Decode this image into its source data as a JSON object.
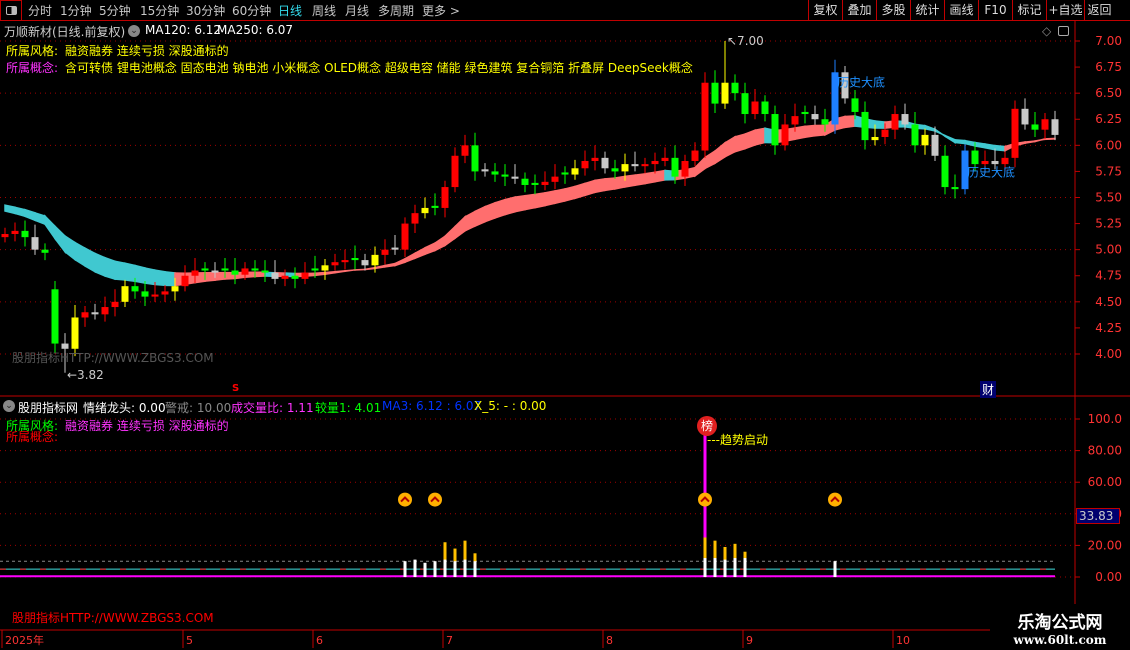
{
  "toolbar": {
    "tabs": [
      "分时",
      "1分钟",
      "5分钟",
      "15分钟",
      "30分钟",
      "60分钟",
      "日线",
      "周线",
      "月线",
      "多周期",
      "更多 >"
    ],
    "active": "日线",
    "buttons": [
      "复权",
      "叠加",
      "多股",
      "统计",
      "画线",
      "F10",
      "标记",
      "+自选",
      "返回"
    ]
  },
  "header": {
    "title": "万顺新材(日线.前复权)",
    "ma120": "MA120: 6.12",
    "ma250": "MA250: 6.07",
    "style_label": "所属风格:",
    "style_value": "融资融券 连续亏损 深股通标的",
    "concept_label": "所属概念:",
    "concept_value": "含可转债 锂电池概念 固态电池 钠电池 小米概念 OLED概念 超级电容 储能 绿色建筑 复合铜箔 折叠屏 DeepSeek概念"
  },
  "main_watermark": "股朋指标HTTP://WWW.ZBGS3.COM",
  "indicator": {
    "name": "股朋指标网",
    "emo": "情绪龙头: 0.00",
    "warn": "警戒: 10.00",
    "volratio": "成交量比: 1.11",
    "jl": "较量1: 4.01",
    "ma3": "MA3: 6.12 : 6.07",
    "x5": "X_5: - : 0.00",
    "style_label": "所属风格:",
    "style_value": "融资融券 连续亏损 深股通标的",
    "concept_label": "所属概念:",
    "badge": "榜",
    "badge_note": "---趋势启动",
    "current_value": "33.83",
    "watermark": "股朋指标HTTP://WWW.ZBGS3.COM"
  },
  "logo": {
    "name": "乐淘公式网",
    "url": "www.60lt.com"
  },
  "markers": {
    "s": "S",
    "cai": "财"
  },
  "colors": {
    "up": "#ff0000",
    "down": "#00ff00",
    "accent": "#33ddee",
    "axis": "#c00000",
    "ma_up": "#ff6e6e",
    "ma_down": "#40c8d0"
  },
  "chart_data": [
    {
      "type": "candlestick",
      "title": "万顺新材(日线.前复权)",
      "y_ticks": [
        "7.00",
        "6.75",
        "6.50",
        "6.25",
        "6.00",
        "5.75",
        "5.50",
        "5.25",
        "5.00",
        "4.75",
        "4.50",
        "4.25",
        "4.00"
      ],
      "ylim": [
        3.75,
        7.1
      ],
      "x_ticks": [
        "2025年",
        "5",
        "6",
        "7",
        "8",
        "9",
        "10"
      ],
      "x_tick_index": [
        0,
        18,
        31,
        44,
        60,
        74,
        89
      ],
      "close": [
        5.15,
        5.18,
        5.12,
        5.0,
        4.97,
        4.1,
        4.05,
        4.35,
        4.4,
        4.38,
        4.45,
        4.5,
        4.65,
        4.6,
        4.55,
        4.57,
        4.6,
        4.65,
        4.75,
        4.8,
        4.8,
        4.78,
        4.8,
        4.76,
        4.82,
        4.8,
        4.78,
        4.72,
        4.75,
        4.72,
        4.78,
        4.8,
        4.85,
        4.88,
        4.9,
        4.9,
        4.85,
        4.95,
        5.0,
        5.0,
        5.25,
        5.35,
        5.4,
        5.4,
        5.6,
        5.9,
        6.0,
        5.75,
        5.75,
        5.72,
        5.7,
        5.68,
        5.62,
        5.62,
        5.65,
        5.7,
        5.72,
        5.78,
        5.85,
        5.88,
        5.78,
        5.75,
        5.82,
        5.8,
        5.82,
        5.85,
        5.88,
        5.7,
        5.85,
        5.95,
        6.6,
        6.4,
        6.6,
        6.5,
        6.3,
        6.42,
        6.3,
        6.0,
        6.2,
        6.28,
        6.3,
        6.25,
        6.2,
        6.7,
        6.45,
        6.32,
        6.05,
        6.08,
        6.15,
        6.3,
        6.2,
        6.0,
        6.1,
        5.9,
        5.6,
        5.58,
        5.95,
        5.82,
        5.85,
        5.82,
        5.88,
        6.35,
        6.2,
        6.15,
        6.25,
        6.1
      ],
      "annotations": [
        {
          "text": "7.00",
          "index": 72,
          "kind": "high"
        },
        {
          "text": "3.82",
          "index": 6,
          "kind": "low"
        },
        {
          "text": "历史大底",
          "index": 83
        },
        {
          "text": "历史大底",
          "index": 96
        }
      ]
    },
    {
      "type": "bar",
      "ylim": [
        0,
        105
      ],
      "y_ticks": [
        "100.0",
        "80.00",
        "60.00",
        "40.00",
        "20.00",
        "0.00"
      ],
      "bars": [
        {
          "i": 40,
          "w": 10,
          "y": 0
        },
        {
          "i": 41,
          "w": 11,
          "y": 0
        },
        {
          "i": 42,
          "w": 9,
          "y": 0
        },
        {
          "i": 43,
          "w": 10,
          "y": 0
        },
        {
          "i": 44,
          "w": 11,
          "y": 22
        },
        {
          "i": 45,
          "w": 10,
          "y": 18
        },
        {
          "i": 46,
          "w": 11,
          "y": 23
        },
        {
          "i": 47,
          "w": 10,
          "y": 15
        },
        {
          "i": 70,
          "w": 12,
          "y": 25
        },
        {
          "i": 71,
          "w": 12,
          "y": 23
        },
        {
          "i": 72,
          "w": 11,
          "y": 19
        },
        {
          "i": 73,
          "w": 12,
          "y": 21
        },
        {
          "i": 74,
          "w": 12,
          "y": 16
        },
        {
          "i": 83,
          "w": 10,
          "y": 0
        }
      ],
      "spike": {
        "i": 70,
        "value": 100
      },
      "up_markers": [
        40,
        43,
        70,
        83
      ],
      "up_marker_value": 49,
      "warn_line": 10
    }
  ]
}
